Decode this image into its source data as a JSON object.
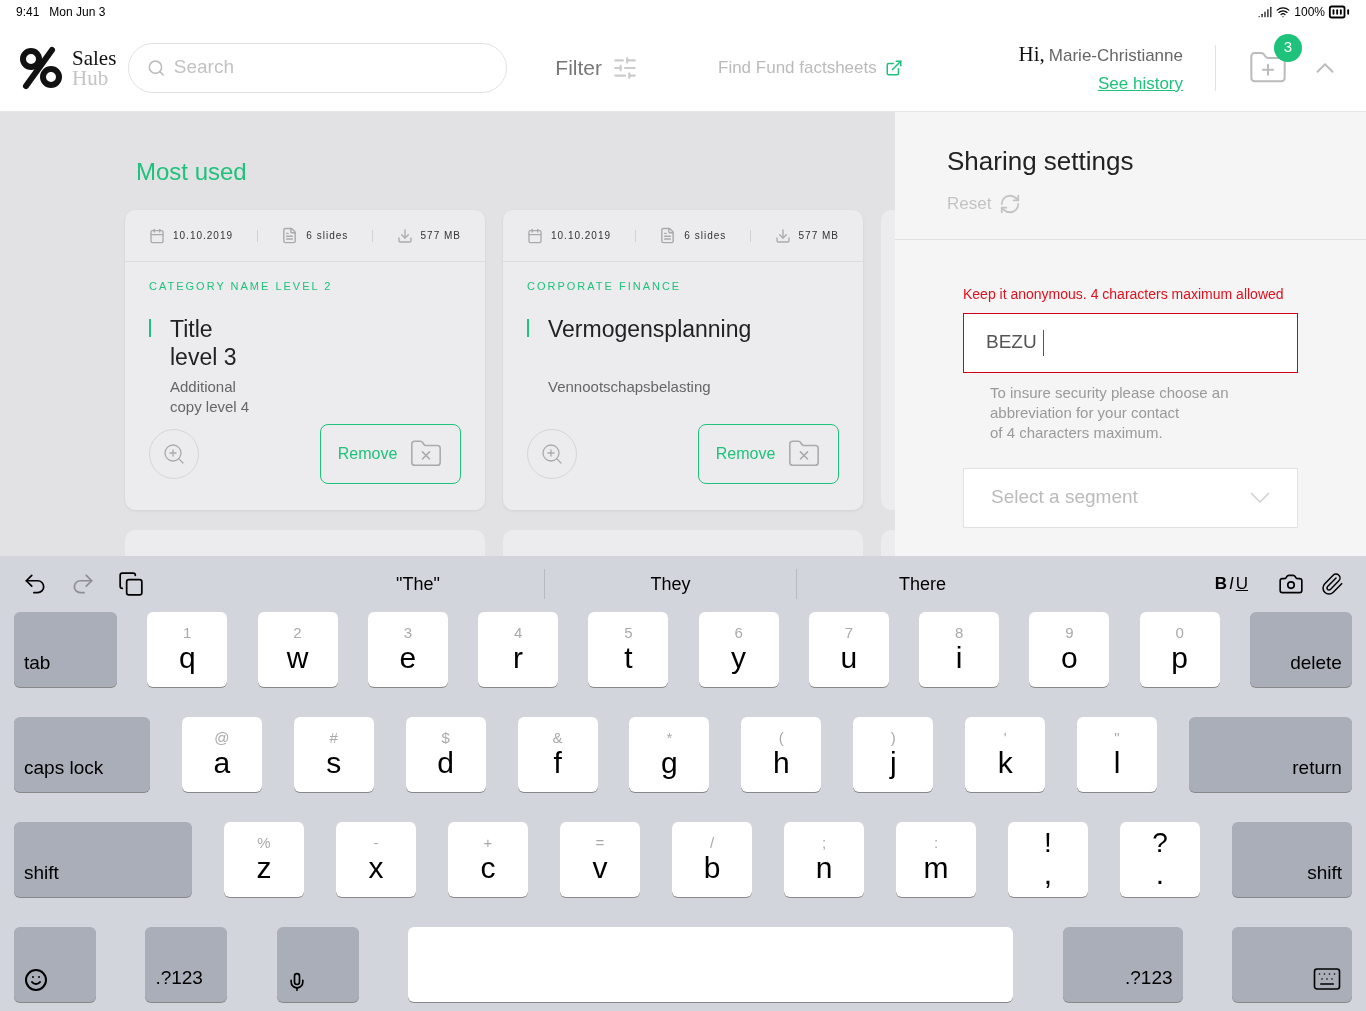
{
  "status_bar": {
    "time": "9:41",
    "date": "Mon Jun 3",
    "battery": "100%"
  },
  "header": {
    "logo_top": "Sales",
    "logo_bottom": "Hub",
    "search": {
      "placeholder": "Search"
    },
    "filter": "Filter",
    "factsheets_link": "Find Fund factsheets",
    "greeting": "Hi,",
    "user": "Marie-Christianne",
    "history_link": "See history",
    "basket_count": "3"
  },
  "section_title": "Most used",
  "cards": [
    {
      "date": "10.10.2019",
      "slides": "6 slides",
      "size": "577 MB",
      "category": "CATEGORY NAME LEVEL 2",
      "title": "Title\nlevel 3",
      "subtitle": "Additional\ncopy level 4",
      "action": "Remove"
    },
    {
      "date": "10.10.2019",
      "slides": "6 slides",
      "size": "577 MB",
      "category": "CORPORATE FINANCE",
      "title": "Vermogensplanning",
      "subtitle": "Vennootschapsbelasting",
      "action": "Remove"
    }
  ],
  "sharing": {
    "title": "Sharing settings",
    "reset": "Reset",
    "error": "Keep it anonymous. 4 characters maximum allowed",
    "field": {
      "value": "BEZU",
      "invalid": true
    },
    "help": "To insure security please choose an\nabbreviation for your contact\nof 4 characters maximum.",
    "segment": {
      "placeholder": "Select a segment"
    }
  },
  "keyboard": {
    "toolbar_left": [
      {
        "kind": "undo",
        "disabled": false
      },
      {
        "kind": "redo",
        "disabled": true
      },
      {
        "kind": "paste",
        "disabled": false
      }
    ],
    "suggestions": [
      "\"The\"",
      "They",
      "There"
    ],
    "format": [
      "B",
      "I",
      "U"
    ],
    "rows": [
      {
        "keys": [
          {
            "kind": "function",
            "label": "tab"
          },
          {
            "kind": "letter",
            "hint": "1",
            "label": "q"
          },
          {
            "kind": "letter",
            "hint": "2",
            "label": "w"
          },
          {
            "kind": "letter",
            "hint": "3",
            "label": "e"
          },
          {
            "kind": "letter",
            "hint": "4",
            "label": "r"
          },
          {
            "kind": "letter",
            "hint": "5",
            "label": "t"
          },
          {
            "kind": "letter",
            "hint": "6",
            "label": "y"
          },
          {
            "kind": "letter",
            "hint": "7",
            "label": "u"
          },
          {
            "kind": "letter",
            "hint": "8",
            "label": "i"
          },
          {
            "kind": "letter",
            "hint": "9",
            "label": "o"
          },
          {
            "kind": "letter",
            "hint": "0",
            "label": "p"
          },
          {
            "kind": "function",
            "label": "delete"
          }
        ]
      },
      {
        "keys": [
          {
            "kind": "function",
            "label": "caps lock"
          },
          {
            "kind": "letter",
            "hint": "@",
            "label": "a"
          },
          {
            "kind": "letter",
            "hint": "#",
            "label": "s"
          },
          {
            "kind": "letter",
            "hint": "$",
            "label": "d"
          },
          {
            "kind": "letter",
            "hint": "&",
            "label": "f"
          },
          {
            "kind": "letter",
            "hint": "*",
            "label": "g"
          },
          {
            "kind": "letter",
            "hint": "(",
            "label": "h"
          },
          {
            "kind": "letter",
            "hint": ")",
            "label": "j"
          },
          {
            "kind": "letter",
            "hint": "'",
            "label": "k"
          },
          {
            "kind": "letter",
            "hint": "\"",
            "label": "l"
          },
          {
            "kind": "function",
            "label": "return"
          }
        ]
      },
      {
        "keys": [
          {
            "kind": "function",
            "label": "shift"
          },
          {
            "kind": "letter",
            "hint": "%",
            "label": "z"
          },
          {
            "kind": "letter",
            "hint": "-",
            "label": "x"
          },
          {
            "kind": "letter",
            "hint": "+",
            "label": "c"
          },
          {
            "kind": "letter",
            "hint": "=",
            "label": "v"
          },
          {
            "kind": "letter",
            "hint": "/",
            "label": "b"
          },
          {
            "kind": "letter",
            "hint": ";",
            "label": "n"
          },
          {
            "kind": "letter",
            "hint": ":",
            "label": "m"
          },
          {
            "kind": "punct",
            "hint": "!",
            "label": ","
          },
          {
            "kind": "punct",
            "hint": "?",
            "label": "."
          },
          {
            "kind": "function",
            "label": "shift"
          }
        ]
      },
      {
        "keys": [
          {
            "kind": "emoji"
          },
          {
            "kind": "function",
            "label": ".?123"
          },
          {
            "kind": "mic"
          },
          {
            "kind": "space"
          },
          {
            "kind": "function",
            "label": ".?123"
          },
          {
            "kind": "hide"
          }
        ]
      }
    ]
  }
}
